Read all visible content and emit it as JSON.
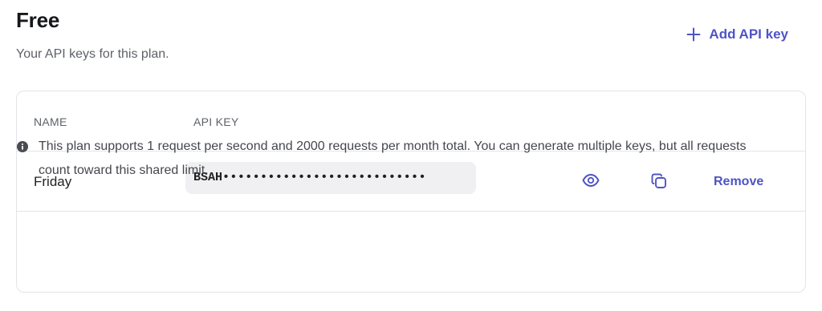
{
  "plan": {
    "title": "Free",
    "subtitle": "Your API keys for this plan."
  },
  "actions": {
    "add_key_label": "Add API key"
  },
  "table": {
    "columns": [
      "NAME",
      "API KEY"
    ],
    "rows": [
      {
        "name": "Friday",
        "key_prefix": "BSAH",
        "key_mask": "•••••••••••••••••••••••••••",
        "remove_label": "Remove"
      }
    ]
  },
  "note": {
    "text": "This plan supports 1 request per second and 2000 requests per month total. You can generate multiple keys, but all requests count toward this shared limit."
  },
  "colors": {
    "accent": "#4f54c4",
    "border": "#e3e4e8",
    "key_background": "#f0f0f2",
    "muted_text": "#5e6168"
  },
  "icons": [
    "plus-icon",
    "eye-icon",
    "copy-icon",
    "info-icon"
  ]
}
